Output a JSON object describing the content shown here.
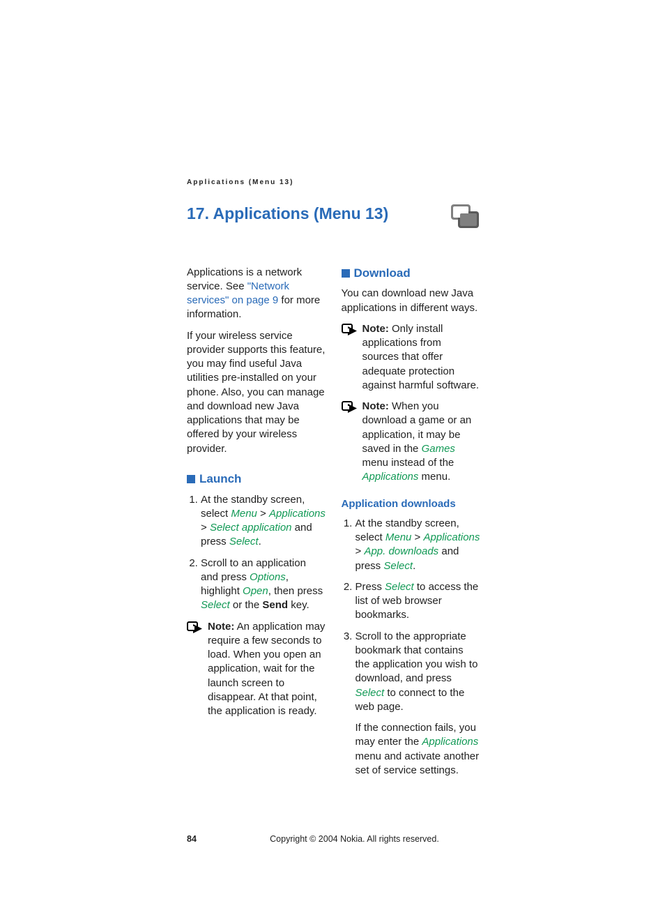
{
  "running_head": "Applications (Menu 13)",
  "chapter_title": "17. Applications (Menu 13)",
  "intro": {
    "p1_a": "Applications is a network service. See ",
    "p1_link": "\"Network services\" on page 9",
    "p1_b": " for more information.",
    "p2": "If your wireless service provider supports this feature, you may find useful Java utilities pre-installed on your phone. Also, you can manage and download new Java applications that may be offered by your wireless provider."
  },
  "launch": {
    "heading": "Launch",
    "li1_a": "At the standby screen, select ",
    "m_menu": "Menu",
    "gt": " > ",
    "m_apps": "Applications",
    "m_selectapp": "Select application",
    "li1_b": " and press ",
    "m_select": "Select",
    "period": ".",
    "li2_a": "Scroll to an application and press ",
    "m_options": "Options",
    "li2_b": ", highlight ",
    "m_open": "Open",
    "li2_c": ", then press ",
    "li2_d": " or the ",
    "send": "Send",
    "li2_e": " key.",
    "note_label": "Note:",
    "note_text": " An application may require a few seconds to load. When you open an application, wait for the launch screen to disappear. At that point, the application is ready."
  },
  "download": {
    "heading": "Download",
    "p1": "You can download new Java applications in different ways.",
    "note1_label": "Note:",
    "note1_text": " Only install applications from sources that offer adequate protection against harmful software.",
    "note2_label": "Note:",
    "note2_a": " When you download a game or an application, it may be saved in the ",
    "m_games": "Games",
    "note2_b": " menu instead of the ",
    "m_apps": "Applications",
    "note2_c": " menu."
  },
  "app_dl": {
    "heading": "Application downloads",
    "li1_a": "At the standby screen, select ",
    "m_menu": "Menu",
    "gt": " > ",
    "m_apps": "Applications",
    "m_appdl": "App. downloads",
    "li1_b": " and press ",
    "m_select": "Select",
    "period": ".",
    "li2_a": "Press ",
    "li2_b": " to access the list of web browser bookmarks.",
    "li3_a": "Scroll to the appropriate bookmark that contains the application you wish to download, and press ",
    "li3_b": " to connect to the web page.",
    "follow_a": "If the connection fails, you may enter the ",
    "follow_b": " menu and activate another set of service settings."
  },
  "footer": {
    "page": "84",
    "copyright": "Copyright © 2004 Nokia. All rights reserved."
  }
}
